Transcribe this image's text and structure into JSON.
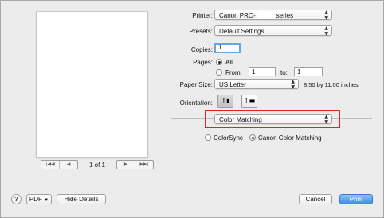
{
  "printer": {
    "label": "Printer:",
    "value_prefix": "Canon PRO-",
    "value_suffix": "series"
  },
  "presets": {
    "label": "Presets:",
    "value": "Default Settings"
  },
  "copies": {
    "label": "Copies:",
    "value": "1"
  },
  "pages": {
    "label": "Pages:",
    "all_label": "All",
    "from_label": "From:",
    "from_value": "1",
    "to_label": "to:",
    "to_value": "1",
    "selected": "All"
  },
  "paper_size": {
    "label": "Paper Size:",
    "value": "US Letter",
    "dimensions": "8.50 by 11.00 inches"
  },
  "orientation": {
    "label": "Orientation:",
    "selected": "portrait"
  },
  "panel_selector": {
    "value": "Color Matching"
  },
  "color_matching": {
    "options": [
      "ColorSync",
      "Canon Color Matching"
    ],
    "selected": "Canon Color Matching"
  },
  "preview": {
    "page_counter": "1 of 1"
  },
  "footer": {
    "help_label": "?",
    "pdf_label": "PDF",
    "hide_details_label": "Hide Details",
    "cancel_label": "Cancel",
    "print_label": "Print"
  },
  "colors": {
    "accent": "#3f8ee8",
    "highlight_box": "#d9262a",
    "dialog_bg": "#ececec"
  }
}
